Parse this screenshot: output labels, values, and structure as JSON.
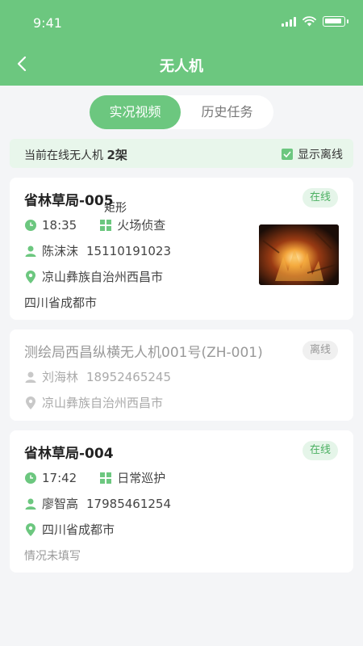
{
  "status_bar": {
    "time": "9:41"
  },
  "header": {
    "title": "无人机"
  },
  "tabs": [
    {
      "label": "实况视频",
      "active": true
    },
    {
      "label": "历史任务",
      "active": false
    }
  ],
  "online_bar": {
    "prefix": "当前在线无人机 ",
    "count": "2架",
    "toggle_label": "显示离线",
    "toggle_checked": true
  },
  "floating_label": "矩形",
  "drones": [
    {
      "name": "省林草局-005",
      "status": "在线",
      "time": "18:35",
      "task": "火场侦查",
      "pilot": "陈沫沫",
      "phone": "15110191023",
      "location": "凉山彝族自治州西昌市",
      "extra": "四川省成都市",
      "has_video": true
    },
    {
      "name": "测绘局西昌纵横无人机001号(ZH-001)",
      "status": "离线",
      "pilot": "刘海林",
      "phone": "18952465245",
      "location": "凉山彝族自治州西昌市"
    },
    {
      "name": "省林草局-004",
      "status": "在线",
      "time": "17:42",
      "task": "日常巡护",
      "pilot": "廖智高",
      "phone": "17985461254",
      "location": "四川省成都市",
      "extra": "情况未填写"
    }
  ],
  "colors": {
    "accent": "#6cc77f",
    "online_badge_text": "#4cb062",
    "offline_text": "#999999"
  }
}
